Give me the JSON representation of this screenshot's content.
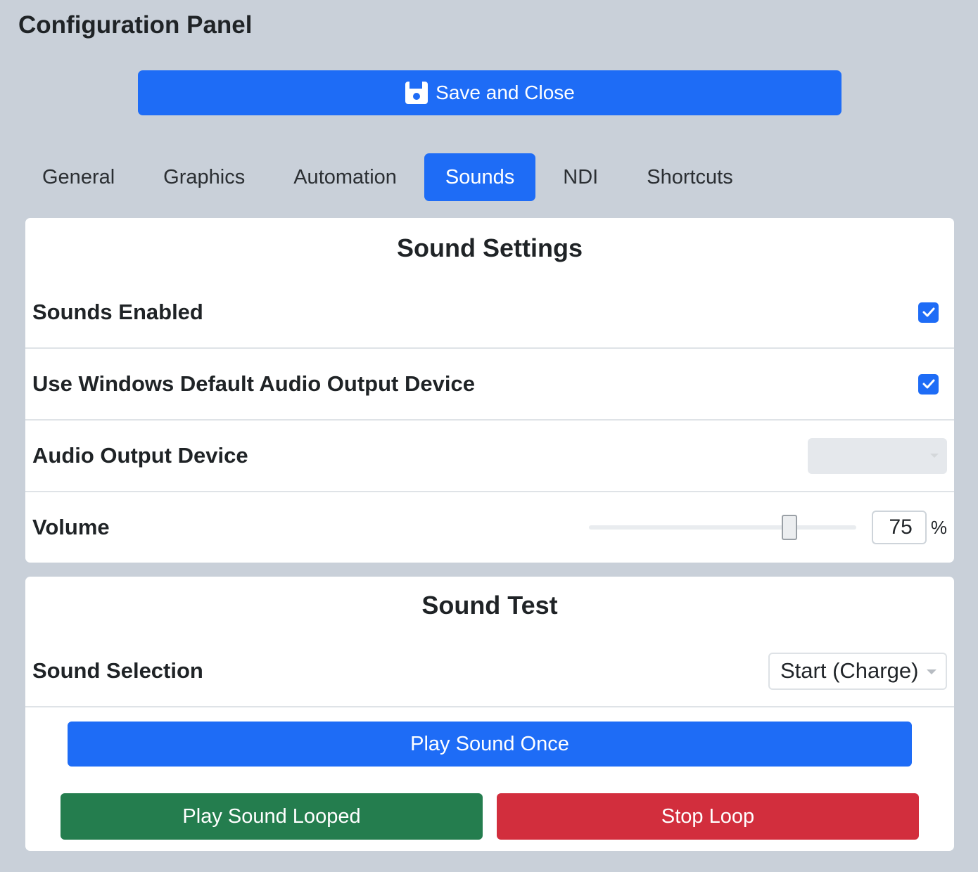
{
  "app": {
    "title": "Configuration Panel"
  },
  "save_button": {
    "label": "Save and Close",
    "icon": "floppy-disk-icon"
  },
  "tabs": [
    {
      "label": "General",
      "active": false
    },
    {
      "label": "Graphics",
      "active": false
    },
    {
      "label": "Automation",
      "active": false
    },
    {
      "label": "Sounds",
      "active": true
    },
    {
      "label": "NDI",
      "active": false
    },
    {
      "label": "Shortcuts",
      "active": false
    }
  ],
  "sound_settings": {
    "title": "Sound Settings",
    "sounds_enabled": {
      "label": "Sounds Enabled",
      "checked": true
    },
    "use_default_device": {
      "label": "Use Windows Default Audio Output Device",
      "checked": true
    },
    "audio_output_device": {
      "label": "Audio Output Device",
      "value": "",
      "disabled": true
    },
    "volume": {
      "label": "Volume",
      "value": "75",
      "unit": "%",
      "fraction": 0.75
    }
  },
  "sound_test": {
    "title": "Sound Test",
    "sound_selection": {
      "label": "Sound Selection",
      "value": "Start (Charge)"
    },
    "play_once_label": "Play Sound Once",
    "play_looped_label": "Play Sound Looped",
    "stop_loop_label": "Stop Loop"
  },
  "colors": {
    "primary": "#1e6cf6",
    "success": "#247d4e",
    "danger": "#d22e3d",
    "background": "#c9d0d9"
  }
}
